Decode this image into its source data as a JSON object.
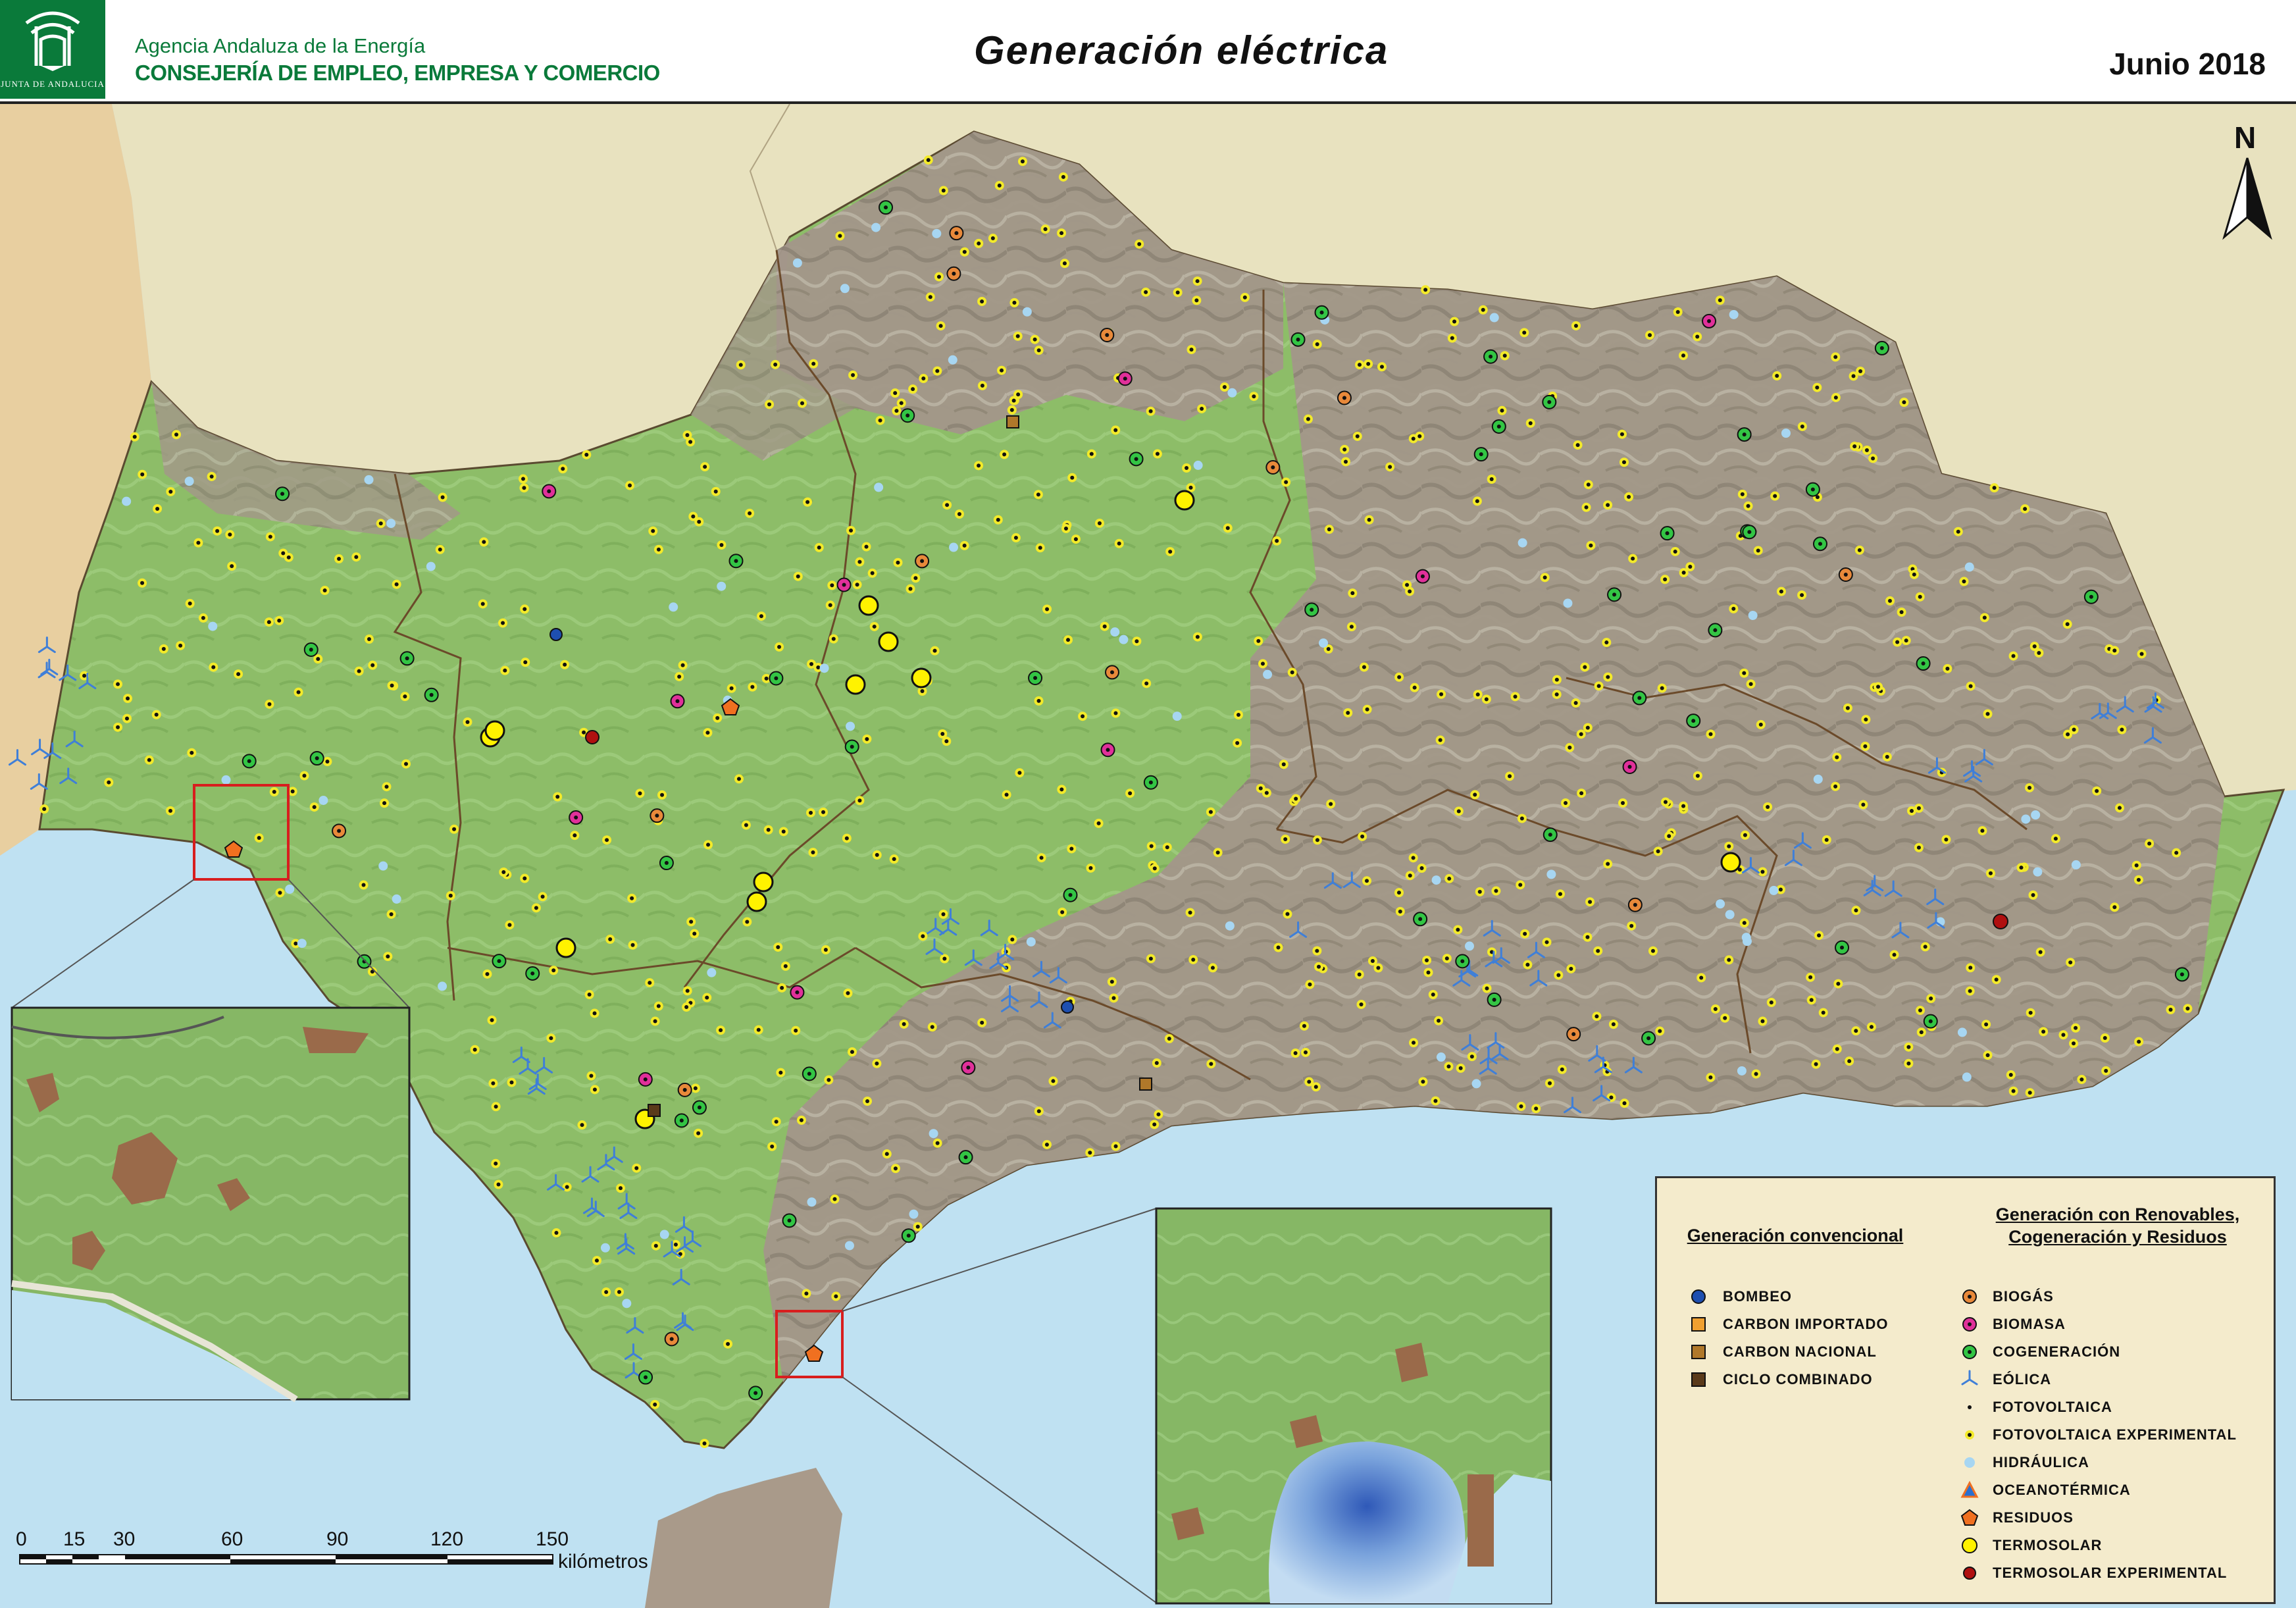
{
  "header": {
    "logo_subtitle": "JUNTA DE ANDALUCIA",
    "agency": "Agencia Andaluza de la Energía",
    "ministry": "CONSEJERÍA DE EMPLEO, EMPRESA Y COMERCIO",
    "title": "Generación  eléctrica",
    "date": "Junio 2018"
  },
  "north_label": "N",
  "scale": {
    "labels": [
      "0",
      "15",
      "30",
      "60",
      "90",
      "120",
      "150"
    ],
    "unit": "kilómetros"
  },
  "legend": {
    "conventional": {
      "title": "Generación convencional",
      "items": [
        {
          "label": "BOMBEO",
          "icon": "circle-dark-blue",
          "color": "#1e4fb0"
        },
        {
          "label": "CARBON  IMPORTADO",
          "icon": "square-orange",
          "color": "#f0a030"
        },
        {
          "label": "CARBON  NACIONAL",
          "icon": "square-brown",
          "color": "#b0782a"
        },
        {
          "label": "CICLO  COMBINADO",
          "icon": "square-dark-brown",
          "color": "#5a3a1a"
        }
      ]
    },
    "renewables": {
      "title_line1": "Generación con Renovables,",
      "title_line2": "Cogeneración y Residuos",
      "items": [
        {
          "label": "BIOGÁS",
          "icon": "circle-orange",
          "color": "#e8893a"
        },
        {
          "label": "BIOMASA",
          "icon": "circle-magenta",
          "color": "#e0309a"
        },
        {
          "label": "COGENERACIÓN",
          "icon": "circle-green",
          "color": "#33c544"
        },
        {
          "label": "EÓLICA",
          "icon": "wind-turbine-icon",
          "color": "#3f7fd8"
        },
        {
          "label": "FOTOVOLTAICA",
          "icon": "dot-black",
          "color": "#111111"
        },
        {
          "label": "FOTOVOLTAICA  EXPERIMENTAL",
          "icon": "star-yellow-black",
          "color": "#f3ea2a"
        },
        {
          "label": "HIDRÁULICA",
          "icon": "circle-light-blue",
          "color": "#a7d6f2"
        },
        {
          "label": "OCEANOTÉRMICA",
          "icon": "triangle-blue-orange",
          "color": "#2a6fd0"
        },
        {
          "label": "RESIDUOS",
          "icon": "pentagon-orange",
          "color": "#f07020"
        },
        {
          "label": "TERMOSOLAR",
          "icon": "circle-yellow",
          "color": "#fff200"
        },
        {
          "label": "TERMOSOLAR  EXPERIMENTAL",
          "icon": "circle-dark-red",
          "color": "#b01010"
        }
      ]
    }
  },
  "map_colors": {
    "sea": "#bfe1f2",
    "neighbor_land": "#e8e2bf",
    "portugal_land": "#e8cfa0",
    "lowland": "#8fbf6a",
    "mountain": "#a89a8c",
    "boundary": "#7a5a3a",
    "inset_frame": "#d81e1e"
  }
}
